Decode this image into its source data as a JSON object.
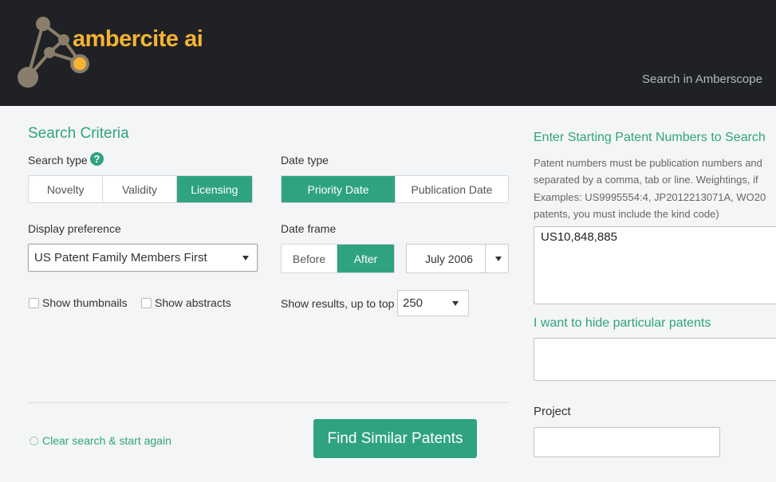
{
  "header": {
    "brand": "ambercite ai",
    "nav_link": "Search in Amberscope"
  },
  "search_criteria": {
    "title": "Search Criteria",
    "search_type": {
      "label": "Search type",
      "options": [
        "Novelty",
        "Validity",
        "Licensing"
      ],
      "selected": "Licensing"
    },
    "date_type": {
      "label": "Date type",
      "options": [
        "Priority Date",
        "Publication Date"
      ],
      "selected": "Priority Date"
    },
    "display_preference": {
      "label": "Display preference",
      "value": "US Patent Family Members First"
    },
    "date_frame": {
      "label": "Date frame",
      "options": [
        "Before",
        "After"
      ],
      "selected": "After",
      "date_value": "July 2006"
    },
    "show_thumbnails_label": "Show thumbnails",
    "show_abstracts_label": "Show abstracts",
    "show_results": {
      "label": "Show results, up to top",
      "value": "250"
    },
    "clear_link": "Clear search & start again",
    "find_button": "Find Similar Patents"
  },
  "right_panel": {
    "title": "Enter Starting Patent Numbers to Search",
    "help_lines": [
      "Patent numbers must be publication numbers and",
      "separated by a comma, tab or line. Weightings, if",
      "Examples: US9995554:4, JP2012213071A, WO20",
      "patents, you must include the kind code)"
    ],
    "patent_input_value": "US10,848,885",
    "hide_title": "I want to hide particular patents",
    "project_label": "Project",
    "project_value": ""
  },
  "colors": {
    "accent": "#2fa37f",
    "header_bg": "#1f2124",
    "brand": "#f5b233"
  }
}
